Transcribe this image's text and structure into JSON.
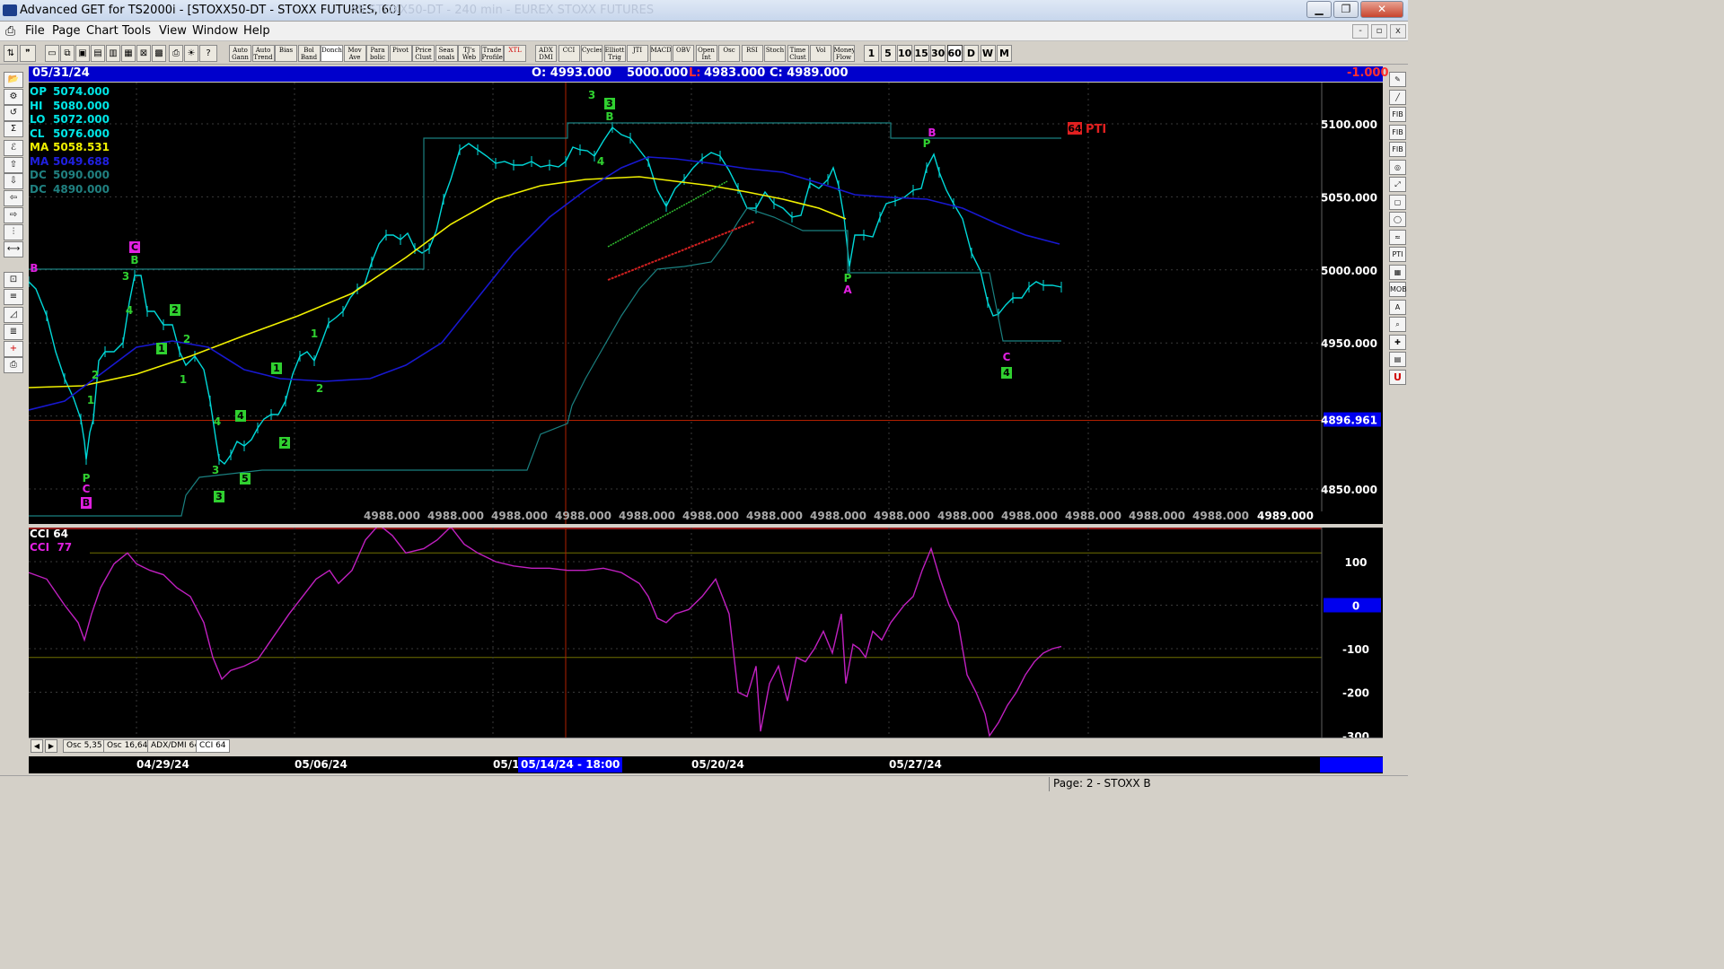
{
  "window": {
    "title": "Advanced GET for TS2000i - [STOXX50-DT - STOXX FUTURES, 60]",
    "ghost_tabs": "45 STOXX50-DT - 240 min - EUREX  STOXX FUTURES"
  },
  "menu": {
    "items": [
      "File",
      "Page",
      "Chart",
      "Tools",
      "View",
      "Window",
      "Help"
    ]
  },
  "toolbar": {
    "study_buttons": [
      {
        "top": "Auto",
        "bottom": "Gann"
      },
      {
        "top": "Auto",
        "bottom": "Trend"
      },
      {
        "top": "Bias",
        "bottom": ""
      },
      {
        "top": "Bol",
        "bottom": "Band"
      },
      {
        "top": "Donch",
        "bottom": ""
      },
      {
        "top": "Mov",
        "bottom": "Ave"
      },
      {
        "top": "Para",
        "bottom": "bolic"
      },
      {
        "top": "Pivot",
        "bottom": ""
      },
      {
        "top": "Price",
        "bottom": "Clust"
      },
      {
        "top": "Seas",
        "bottom": "onals"
      },
      {
        "top": "TJ's",
        "bottom": "Web"
      },
      {
        "top": "Trade",
        "bottom": "Profile"
      },
      {
        "top": "XTL",
        "bottom": ""
      }
    ],
    "osc_buttons": [
      {
        "top": "ADX",
        "bottom": "DMI"
      },
      {
        "top": "CCI",
        "bottom": ""
      },
      {
        "top": "Cycles",
        "bottom": ""
      },
      {
        "top": "Elliott",
        "bottom": "Trig"
      },
      {
        "top": "JTI",
        "bottom": ""
      },
      {
        "top": "MACD",
        "bottom": ""
      },
      {
        "top": "OBV",
        "bottom": ""
      },
      {
        "top": "Open",
        "bottom": "Int"
      },
      {
        "top": "Osc",
        "bottom": ""
      },
      {
        "top": "RSI",
        "bottom": ""
      },
      {
        "top": "Stoch",
        "bottom": ""
      },
      {
        "top": "Time",
        "bottom": "Clust"
      },
      {
        "top": "Vol",
        "bottom": ""
      },
      {
        "top": "Money",
        "bottom": "Flow"
      }
    ],
    "periods": [
      "1",
      "5",
      "10",
      "15",
      "30",
      "60",
      "D",
      "W",
      "M"
    ],
    "active_period": "60"
  },
  "lefttools": [
    "folder",
    "cycle",
    "reset",
    "study",
    "elliott",
    "up",
    "down",
    "left",
    "right",
    "bars",
    "expand",
    "zoom",
    "lines",
    "gann",
    "fib",
    "cross",
    "print"
  ],
  "righttools": [
    "pencil",
    "line",
    "fib-ret",
    "fib-ext",
    "fib-time",
    "ellipse",
    "fan",
    "square",
    "ellipse2",
    "wave",
    "PTI",
    "grid",
    "MOB",
    "A",
    "magnify",
    "marker",
    "table",
    "magnet"
  ],
  "chart_header": {
    "date": "05/31/24",
    "open": "O: 4993.000",
    "high": "5000.000",
    "low_label": "L:",
    "low": "4983.000",
    "close": "C: 4989.000",
    "change": "-1.000"
  },
  "legend": [
    {
      "label": "OP",
      "value": "5074.000",
      "color": "#00e5e5"
    },
    {
      "label": "HI",
      "value": "5080.000",
      "color": "#00e5e5"
    },
    {
      "label": "LO",
      "value": "5072.000",
      "color": "#00e5e5"
    },
    {
      "label": "CL",
      "value": "5076.000",
      "color": "#00e5e5"
    },
    {
      "label": "MA",
      "value": "5058.531",
      "color": "#f0f000"
    },
    {
      "label": "MA",
      "value": "5049.688",
      "color": "#2020e0"
    },
    {
      "label": "DC",
      "value": "5090.000",
      "color": "#208080"
    },
    {
      "label": "DC",
      "value": "4890.000",
      "color": "#208080"
    }
  ],
  "price_axis": {
    "labels": [
      "5100.000",
      "5050.000",
      "5000.000",
      "4950.000",
      "4850.000"
    ],
    "cursor_value": "4896.961",
    "bottom_values": [
      "4988.000",
      "4988.000",
      "4988.000",
      "4988.000",
      "4988.000",
      "4988.000",
      "4988.000",
      "4988.000",
      "4988.000",
      "4988.000",
      "4988.000",
      "4988.000",
      "4988.000",
      "4988.000"
    ],
    "last_value": "4989.000"
  },
  "pti": {
    "value": "64",
    "label": "PTI"
  },
  "wave_labels": {
    "b_left": "B",
    "three": "3",
    "c_top": "C",
    "b_top": "B",
    "three_top": "3",
    "b_peak": "B",
    "four_peak": "4",
    "b_right": "B",
    "p_right": "P",
    "p_a": "P",
    "a_label": "A",
    "c_right": "C",
    "four_right": "4",
    "one": "1",
    "two": "2",
    "four": "4",
    "five": "5",
    "p_left": "P",
    "c_left": "C",
    "b_left_box": "B"
  },
  "cci_panel": {
    "title": "CCI 64",
    "label": "CCI",
    "value": "77",
    "axis": [
      "100",
      "0",
      "-100",
      "-200",
      "-300"
    ]
  },
  "panel_tabs": [
    "Osc 5,35",
    "Osc 16,64",
    "ADX/DMI 64",
    "CCI 64"
  ],
  "active_tab": "CCI 64",
  "date_axis": {
    "labels": [
      "04/29/24",
      "05/06/24",
      "05/1",
      "05/20/24",
      "05/27/24"
    ],
    "cursor_date": "05/14/24 - 18:00"
  },
  "status": {
    "page": "Page: 2 - STOXX B"
  }
}
